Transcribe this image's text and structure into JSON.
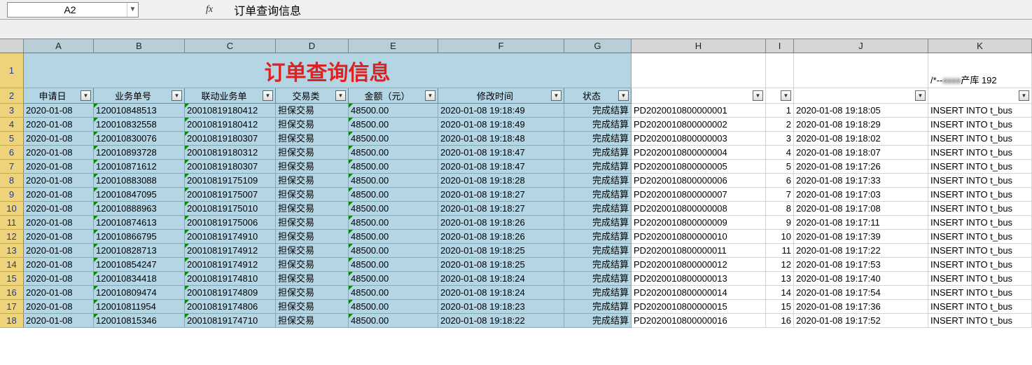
{
  "formula_bar": {
    "cell_ref": "A2",
    "fx": "fx",
    "content": "订单查询信息"
  },
  "columns": [
    "A",
    "B",
    "C",
    "D",
    "E",
    "F",
    "G",
    "H",
    "I",
    "J",
    "K"
  ],
  "title_text": "订单查询信息",
  "header_row_num": "2",
  "headers": {
    "A": "申请日",
    "B": "业务单号",
    "C": "联动业务单",
    "D": "交易类",
    "E": "金额（元）",
    "F": "修改时间",
    "G": "状态"
  },
  "k1_text_prefix": "/*--",
  "k1_text_blur": "xxxx",
  "k1_text_suffix": "产库 192",
  "rows": [
    {
      "n": "3",
      "A": "2020-01-08",
      "B": "120010848513",
      "C": "20010819180412",
      "D": "担保交易",
      "E": "48500.00",
      "F": "2020-01-08 19:18:49",
      "G": "完成结算",
      "H": "PD2020010800000001",
      "I": "1",
      "J": "2020-01-08 19:18:05",
      "K": "INSERT INTO t_bus"
    },
    {
      "n": "4",
      "A": "2020-01-08",
      "B": "120010832558",
      "C": "20010819180412",
      "D": "担保交易",
      "E": "48500.00",
      "F": "2020-01-08 19:18:49",
      "G": "完成结算",
      "H": "PD2020010800000002",
      "I": "2",
      "J": "2020-01-08 19:18:29",
      "K": "INSERT INTO t_bus"
    },
    {
      "n": "5",
      "A": "2020-01-08",
      "B": "120010830076",
      "C": "20010819180307",
      "D": "担保交易",
      "E": "48500.00",
      "F": "2020-01-08 19:18:48",
      "G": "完成结算",
      "H": "PD2020010800000003",
      "I": "3",
      "J": "2020-01-08 19:18:02",
      "K": "INSERT INTO t_bus"
    },
    {
      "n": "6",
      "A": "2020-01-08",
      "B": "120010893728",
      "C": "20010819180312",
      "D": "担保交易",
      "E": "48500.00",
      "F": "2020-01-08 19:18:47",
      "G": "完成结算",
      "H": "PD2020010800000004",
      "I": "4",
      "J": "2020-01-08 19:18:07",
      "K": "INSERT INTO t_bus"
    },
    {
      "n": "7",
      "A": "2020-01-08",
      "B": "120010871612",
      "C": "20010819180307",
      "D": "担保交易",
      "E": "48500.00",
      "F": "2020-01-08 19:18:47",
      "G": "完成结算",
      "H": "PD2020010800000005",
      "I": "5",
      "J": "2020-01-08 19:17:26",
      "K": "INSERT INTO t_bus"
    },
    {
      "n": "8",
      "A": "2020-01-08",
      "B": "120010883088",
      "C": "20010819175109",
      "D": "担保交易",
      "E": "48500.00",
      "F": "2020-01-08 19:18:28",
      "G": "完成结算",
      "H": "PD2020010800000006",
      "I": "6",
      "J": "2020-01-08 19:17:33",
      "K": "INSERT INTO t_bus"
    },
    {
      "n": "9",
      "A": "2020-01-08",
      "B": "120010847095",
      "C": "20010819175007",
      "D": "担保交易",
      "E": "48500.00",
      "F": "2020-01-08 19:18:27",
      "G": "完成结算",
      "H": "PD2020010800000007",
      "I": "7",
      "J": "2020-01-08 19:17:03",
      "K": "INSERT INTO t_bus"
    },
    {
      "n": "10",
      "A": "2020-01-08",
      "B": "120010888963",
      "C": "20010819175010",
      "D": "担保交易",
      "E": "48500.00",
      "F": "2020-01-08 19:18:27",
      "G": "完成结算",
      "H": "PD2020010800000008",
      "I": "8",
      "J": "2020-01-08 19:17:08",
      "K": "INSERT INTO t_bus"
    },
    {
      "n": "11",
      "A": "2020-01-08",
      "B": "120010874613",
      "C": "20010819175006",
      "D": "担保交易",
      "E": "48500.00",
      "F": "2020-01-08 19:18:26",
      "G": "完成结算",
      "H": "PD2020010800000009",
      "I": "9",
      "J": "2020-01-08 19:17:11",
      "K": "INSERT INTO t_bus"
    },
    {
      "n": "12",
      "A": "2020-01-08",
      "B": "120010866795",
      "C": "20010819174910",
      "D": "担保交易",
      "E": "48500.00",
      "F": "2020-01-08 19:18:26",
      "G": "完成结算",
      "H": "PD2020010800000010",
      "I": "10",
      "J": "2020-01-08 19:17:39",
      "K": "INSERT INTO t_bus"
    },
    {
      "n": "13",
      "A": "2020-01-08",
      "B": "120010828713",
      "C": "20010819174912",
      "D": "担保交易",
      "E": "48500.00",
      "F": "2020-01-08 19:18:25",
      "G": "完成结算",
      "H": "PD2020010800000011",
      "I": "11",
      "J": "2020-01-08 19:17:22",
      "K": "INSERT INTO t_bus"
    },
    {
      "n": "14",
      "A": "2020-01-08",
      "B": "120010854247",
      "C": "20010819174912",
      "D": "担保交易",
      "E": "48500.00",
      "F": "2020-01-08 19:18:25",
      "G": "完成结算",
      "H": "PD2020010800000012",
      "I": "12",
      "J": "2020-01-08 19:17:53",
      "K": "INSERT INTO t_bus"
    },
    {
      "n": "15",
      "A": "2020-01-08",
      "B": "120010834418",
      "C": "20010819174810",
      "D": "担保交易",
      "E": "48500.00",
      "F": "2020-01-08 19:18:24",
      "G": "完成结算",
      "H": "PD2020010800000013",
      "I": "13",
      "J": "2020-01-08 19:17:40",
      "K": "INSERT INTO t_bus"
    },
    {
      "n": "16",
      "A": "2020-01-08",
      "B": "120010809474",
      "C": "20010819174809",
      "D": "担保交易",
      "E": "48500.00",
      "F": "2020-01-08 19:18:24",
      "G": "完成结算",
      "H": "PD2020010800000014",
      "I": "14",
      "J": "2020-01-08 19:17:54",
      "K": "INSERT INTO t_bus"
    },
    {
      "n": "17",
      "A": "2020-01-08",
      "B": "120010811954",
      "C": "20010819174806",
      "D": "担保交易",
      "E": "48500.00",
      "F": "2020-01-08 19:18:23",
      "G": "完成结算",
      "H": "PD2020010800000015",
      "I": "15",
      "J": "2020-01-08 19:17:36",
      "K": "INSERT INTO t_bus"
    },
    {
      "n": "18",
      "A": "2020-01-08",
      "B": "120010815346",
      "C": "20010819174710",
      "D": "担保交易",
      "E": "48500.00",
      "F": "2020-01-08 19:18:22",
      "G": "完成结算",
      "H": "PD2020010800000016",
      "I": "16",
      "J": "2020-01-08 19:17:52",
      "K": "INSERT INTO t_bus"
    }
  ]
}
